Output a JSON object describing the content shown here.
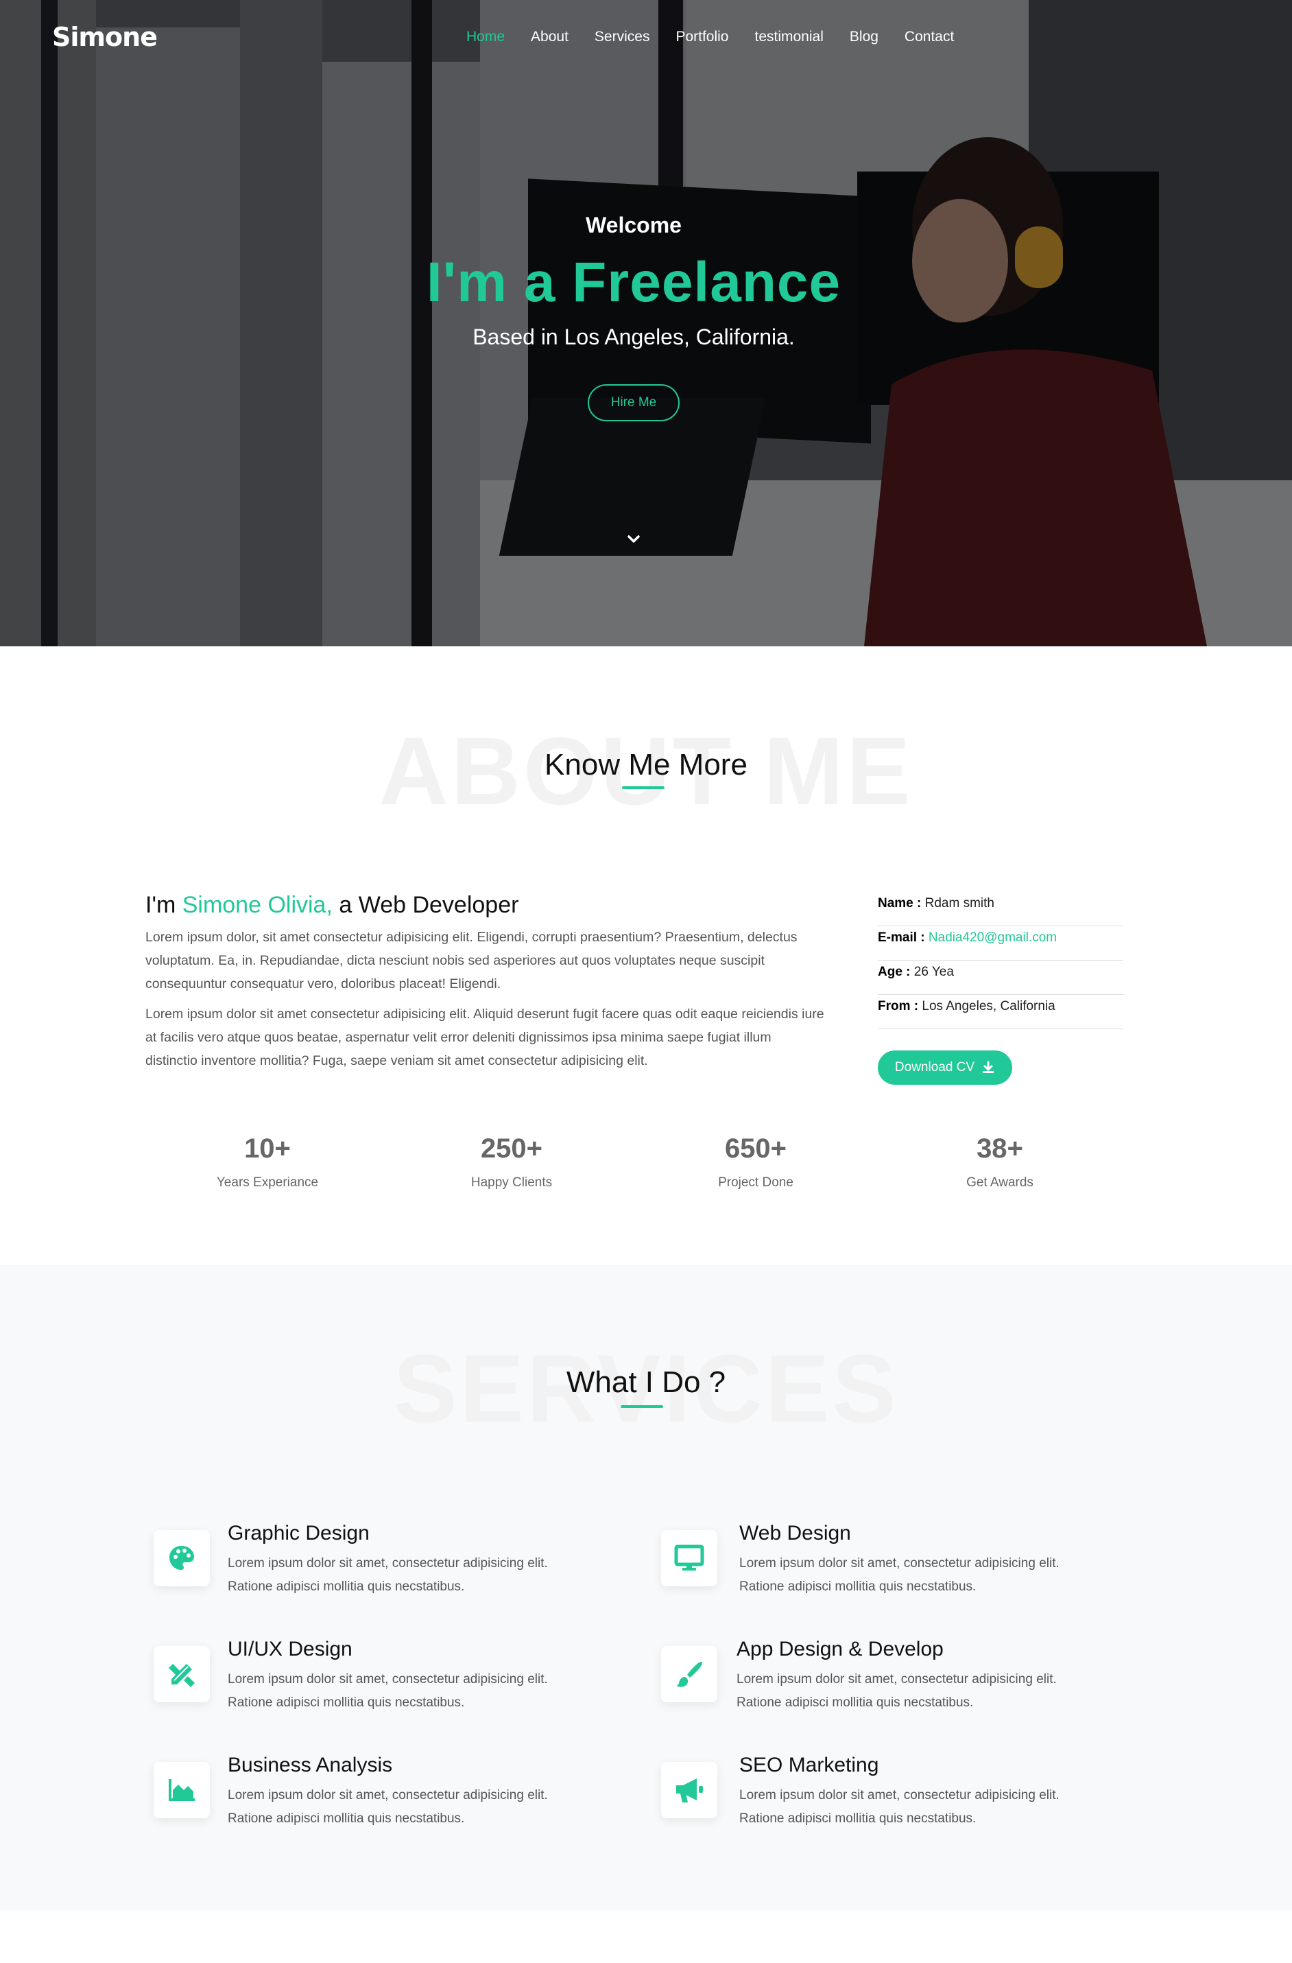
{
  "nav": {
    "brand": "Simone",
    "items": [
      {
        "label": "Home",
        "active": true
      },
      {
        "label": "About",
        "active": false
      },
      {
        "label": "Services",
        "active": false
      },
      {
        "label": "Portfolio",
        "active": false
      },
      {
        "label": "testimonial",
        "active": false
      },
      {
        "label": "Blog",
        "active": false
      },
      {
        "label": "Contact",
        "active": false
      }
    ]
  },
  "hero": {
    "welcome": "Welcome",
    "headline": "I'm a Freelance",
    "subline": "Based in Los Angeles, California.",
    "cta": "Hire Me",
    "scroll_icon": "chevron-down-icon"
  },
  "about": {
    "ghost": "ABOUT ME",
    "title": "Know Me More",
    "intro_prefix": "I'm ",
    "intro_name": "Simone Olivia,",
    "intro_suffix": " a Web Developer",
    "para1": "Lorem ipsum dolor, sit amet consectetur adipisicing elit. Eligendi, corrupti praesentium? Praesentium, delectus voluptatum. Ea, in. Repudiandae, dicta nesciunt nobis sed asperiores aut quos voluptates neque suscipit consequuntur consequatur vero, doloribus placeat! Eligendi.",
    "para2": "Lorem ipsum dolor sit amet consectetur adipisicing elit. Aliquid deserunt fugit facere quas odit eaque reiciendis iure at facilis vero atque quos beatae, aspernatur velit error deleniti dignissimos ipsa minima saepe fugiat illum distinctio inventore mollitia? Fuga, saepe veniam sit amet consectetur adipisicing elit.",
    "info": [
      {
        "key": "Name :",
        "value": "Rdam smith"
      },
      {
        "key": "E-mail :",
        "value": "Nadia420@gmail.com"
      },
      {
        "key": "Age :",
        "value": "26 Yea"
      },
      {
        "key": "From :",
        "value": "Los Angeles, California"
      }
    ],
    "download": "Download CV",
    "download_icon": "download-icon",
    "stats": [
      {
        "num": "10+",
        "label": "Years Experiance"
      },
      {
        "num": "250+",
        "label": "Happy Clients"
      },
      {
        "num": "650+",
        "label": "Project Done"
      },
      {
        "num": "38+",
        "label": "Get Awards"
      }
    ]
  },
  "services": {
    "ghost": "SERVICES",
    "title": "What I Do ?",
    "items": [
      {
        "title": "Graphic Design",
        "icon": "palette-icon",
        "line1": "Lorem ipsum dolor sit amet, consectetur adipisicing elit.",
        "line2": "Ratione adipisci mollitia quis necstatibus."
      },
      {
        "title": "Web Design",
        "icon": "desktop-icon",
        "line1": "Lorem ipsum dolor sit amet, consectetur adipisicing elit.",
        "line2": "Ratione adipisci mollitia quis necstatibus."
      },
      {
        "title": "UI/UX Design",
        "icon": "pencil-ruler-icon",
        "line1": "Lorem ipsum dolor sit amet, consectetur adipisicing elit.",
        "line2": "Ratione adipisci mollitia quis necstatibus."
      },
      {
        "title": "App Design & Develop",
        "icon": "paint-brush-icon",
        "line1": "Lorem ipsum dolor sit amet, consectetur adipisicing elit.",
        "line2": "Ratione adipisci mollitia quis necstatibus."
      },
      {
        "title": "Business Analysis",
        "icon": "area-chart-icon",
        "line1": "Lorem ipsum dolor sit amet, consectetur adipisicing elit.",
        "line2": "Ratione adipisci mollitia quis necstatibus."
      },
      {
        "title": "SEO Marketing",
        "icon": "megaphone-icon",
        "line1": "Lorem ipsum dolor sit amet, consectetur adipisicing elit.",
        "line2": "Ratione adipisci mollitia quis necstatibus."
      }
    ]
  },
  "colors": {
    "accent": "#20c997",
    "text": "#555555",
    "section_bg": "#f8f9fa"
  }
}
